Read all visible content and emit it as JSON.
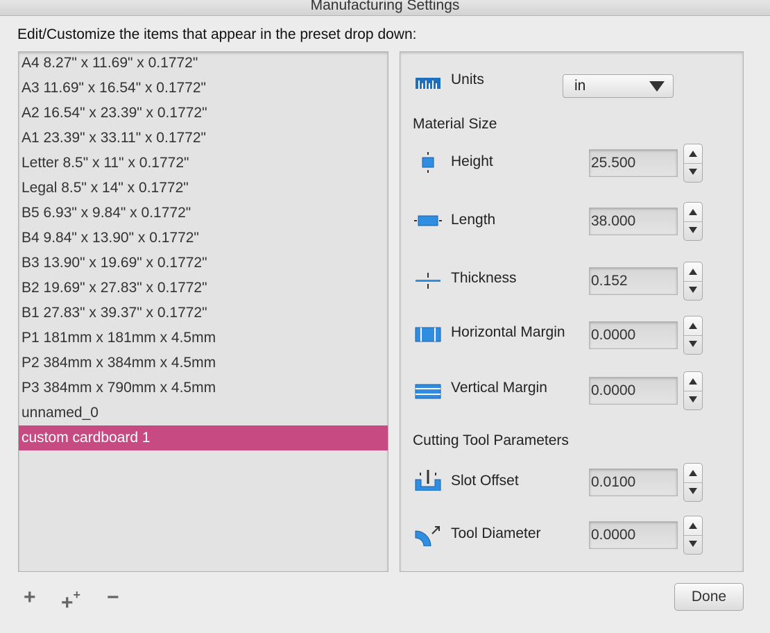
{
  "window": {
    "title": "Manufacturing Settings"
  },
  "instruction": "Edit/Customize the items that appear in the preset drop down:",
  "presets": [
    "A4 8.27\" x 11.69\" x 0.1772\"",
    "A3 11.69\" x 16.54\" x 0.1772\"",
    "A2 16.54\" x 23.39\" x 0.1772\"",
    "A1 23.39\" x 33.11\" x 0.1772\"",
    "Letter 8.5\" x 11\" x 0.1772\"",
    "Legal 8.5\" x 14\" x 0.1772\"",
    "B5 6.93\" x 9.84\" x 0.1772\"",
    "B4 9.84\" x 13.90\" x 0.1772\"",
    "B3 13.90\" x 19.69\" x 0.1772\"",
    "B2 19.69\" x 27.83\" x 0.1772\"",
    "B1 27.83\" x 39.37\" x 0.1772\"",
    "P1 181mm x 181mm x 4.5mm",
    "P2 384mm x 384mm x 4.5mm",
    "P3 384mm x 790mm x 4.5mm",
    "unnamed_0",
    "custom cardboard 1"
  ],
  "selected_preset": "custom cardboard 1",
  "settings": {
    "units_label": "Units",
    "units_value": "in",
    "material_section": "Material Size",
    "height_label": "Height",
    "height_value": "25.500",
    "length_label": "Length",
    "length_value": "38.000",
    "thickness_label": "Thickness",
    "thickness_value": "0.152",
    "hmargin_label": "Horizontal Margin",
    "hmargin_value": "0.0000",
    "vmargin_label": "Vertical Margin",
    "vmargin_value": "0.0000",
    "tool_section": "Cutting Tool Parameters",
    "slot_label": "Slot  Offset",
    "slot_value": "0.0100",
    "tooldia_label": "Tool Diameter",
    "tooldia_value": "0.0000"
  },
  "toolbar": {
    "add": "+",
    "add_multi": "+",
    "add_multi_sup": "+",
    "remove": "−"
  },
  "done_label": "Done",
  "colors": {
    "selection": "#c84a82",
    "icon_blue": "#2f8ee0"
  }
}
